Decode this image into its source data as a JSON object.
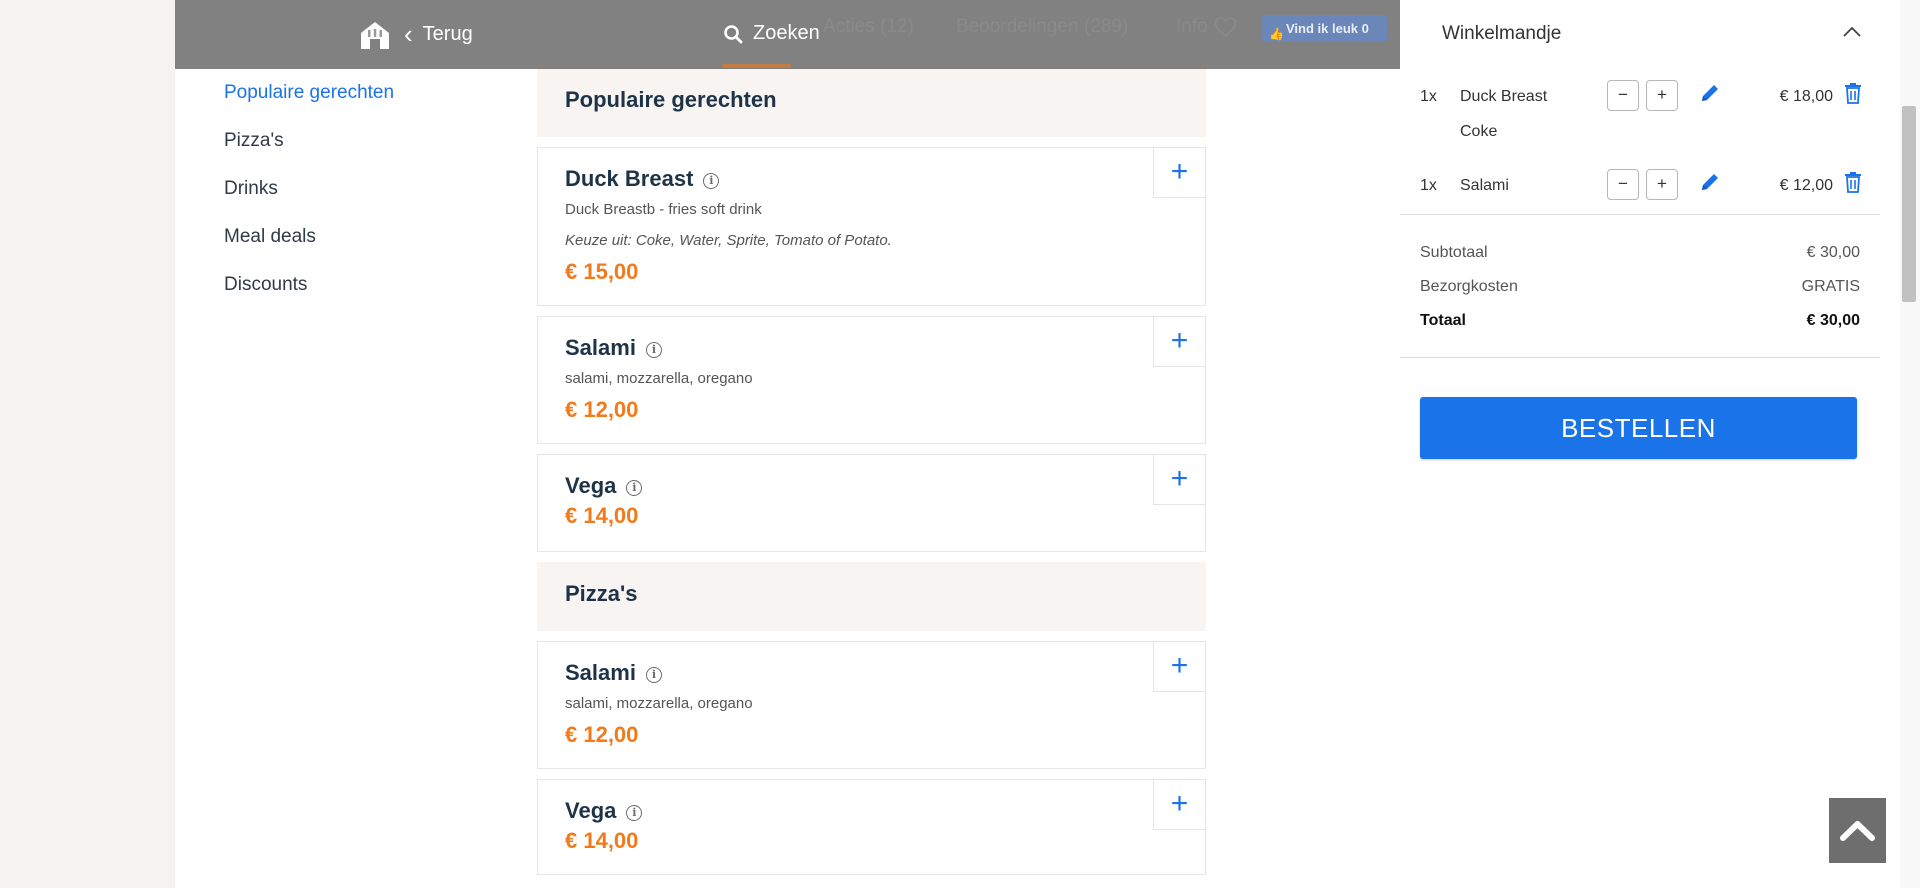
{
  "header": {
    "back_label": "Terug",
    "search_label": "Zoeken",
    "tabs": {
      "acties": "Acties (12)",
      "beoordelingen": "Beoordelingen (289)",
      "info": "Info"
    },
    "like_label": "Vind ik leuk 0"
  },
  "categories": [
    {
      "label": "Populaire gerechten"
    },
    {
      "label": "Pizza's"
    },
    {
      "label": "Drinks"
    },
    {
      "label": "Meal deals"
    },
    {
      "label": "Discounts"
    }
  ],
  "menu": {
    "sections": [
      {
        "title": "Populaire gerechten",
        "items": [
          {
            "name": "Duck Breast",
            "description": "Duck Breastb - fries soft drink",
            "choice": "Keuze uit: Coke, Water, Sprite, Tomato of Potato.",
            "price": "€ 15,00"
          },
          {
            "name": "Salami",
            "description": "salami, mozzarella, oregano",
            "price": "€ 12,00"
          },
          {
            "name": "Vega",
            "price": "€ 14,00"
          }
        ]
      },
      {
        "title": "Pizza's",
        "items": [
          {
            "name": "Salami",
            "description": "salami, mozzarella, oregano",
            "price": "€ 12,00"
          },
          {
            "name": "Vega",
            "price": "€ 14,00"
          }
        ]
      }
    ]
  },
  "cart": {
    "title": "Winkelmandje",
    "lines": [
      {
        "qty": "1x",
        "name": "Duck Breast",
        "option": "Coke",
        "price": "€ 18,00"
      },
      {
        "qty": "1x",
        "name": "Salami",
        "price": "€ 12,00"
      }
    ],
    "subtotal_label": "Subtotaal",
    "subtotal_value": "€ 30,00",
    "delivery_label": "Bezorgkosten",
    "delivery_value": "GRATIS",
    "total_label": "Totaal",
    "total_value": "€ 30,00",
    "order_button": "BESTELLEN"
  },
  "colors": {
    "accent": "#1a73e8",
    "price": "#f27a1a",
    "heading": "#1e3347"
  }
}
